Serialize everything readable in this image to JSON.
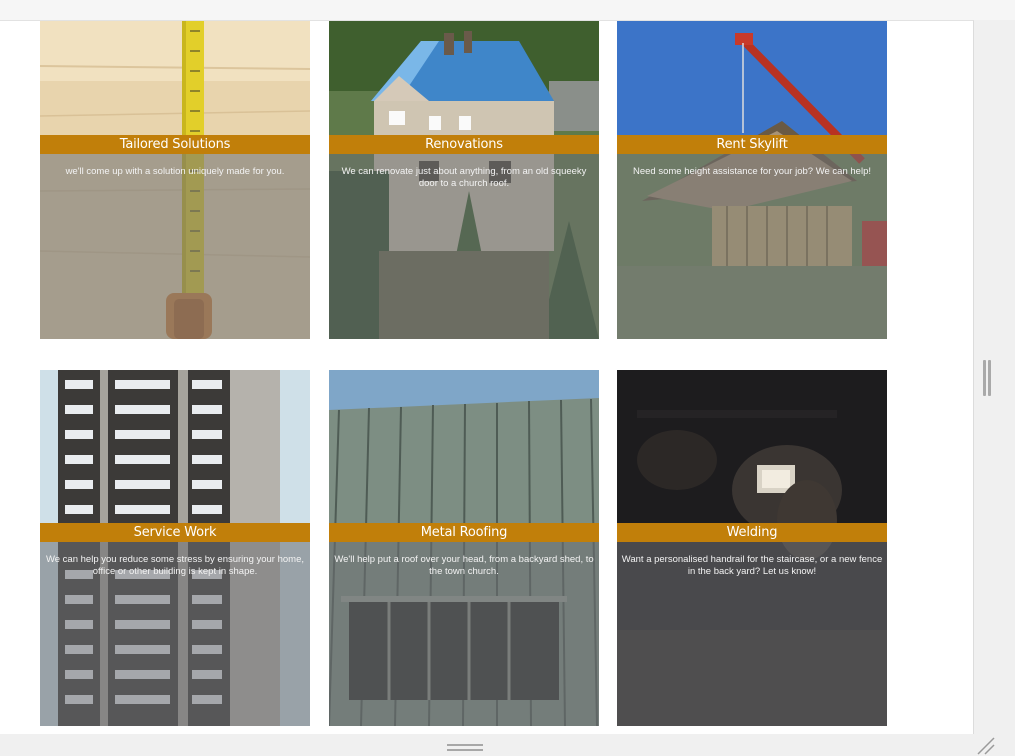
{
  "cards": [
    {
      "title": "Tailored Solutions",
      "description": "we'll come up with a solution uniquely made for you."
    },
    {
      "title": "Renovations",
      "description": "We can renovate just about anything, from an old squeeky door to a church roof."
    },
    {
      "title": "Rent Skylift",
      "description": "Need some height assistance for your job? We can help!"
    },
    {
      "title": "Service Work",
      "description": "We can help you reduce some stress by ensuring your home, office or other building is kept in shape."
    },
    {
      "title": "Metal Roofing",
      "description": "We'll help put a roof over your head, from a backyard shed, to the town church."
    },
    {
      "title": "Welding",
      "description": "Want a personalised handrail for the staircase, or a new fence in the back yard? Let us know!"
    }
  ],
  "colors": {
    "title_bar": "#c17f0a",
    "overlay": "#6e7073"
  },
  "icons": [
    "vertical-resize-handle-icon",
    "horizontal-resize-handle-icon",
    "corner-resize-grip-icon"
  ]
}
